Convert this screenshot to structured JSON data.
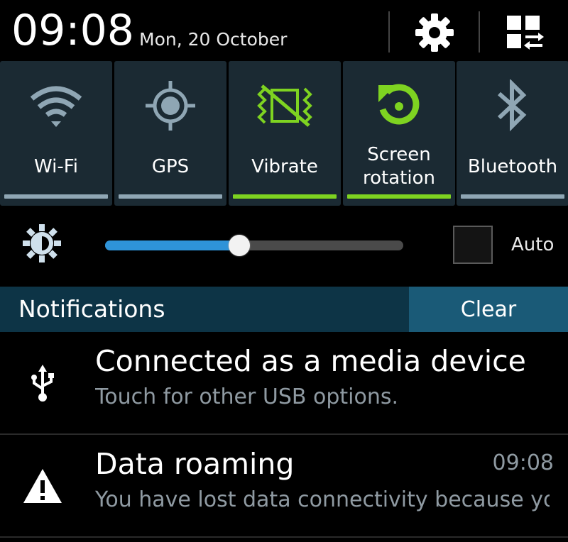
{
  "status": {
    "time": "09:08",
    "date": "Mon, 20 October"
  },
  "header_icons": [
    "settings-icon",
    "edit-panels-icon"
  ],
  "toggles": [
    {
      "label": "Wi-Fi",
      "icon": "wifi-icon",
      "on": false
    },
    {
      "label": "GPS",
      "icon": "gps-icon",
      "on": false
    },
    {
      "label": "Vibrate",
      "icon": "vibrate-icon",
      "on": true
    },
    {
      "label": "Screen rotation",
      "icon": "screen-rotation-icon",
      "on": true
    },
    {
      "label": "Bluetooth",
      "icon": "bluetooth-icon",
      "on": false
    }
  ],
  "brightness": {
    "level": 0.45,
    "auto_label": "Auto",
    "auto_checked": false
  },
  "notifications_header": {
    "title": "Notifications",
    "clear_label": "Clear"
  },
  "notifications": [
    {
      "title": "Connected as a media device",
      "text": "Touch for other USB options.",
      "time": "",
      "icon": "usb-icon"
    },
    {
      "title": "Data roaming",
      "text": "You have lost data connectivity because yo..",
      "time": "09:08",
      "icon": "warning-icon"
    }
  ],
  "colors": {
    "accent_on": "#7ed321",
    "accent_off": "#8fa6b4",
    "slider_fill": "#2e93d8",
    "header_bg": "#0d3446",
    "clear_bg": "#1a5a77"
  }
}
